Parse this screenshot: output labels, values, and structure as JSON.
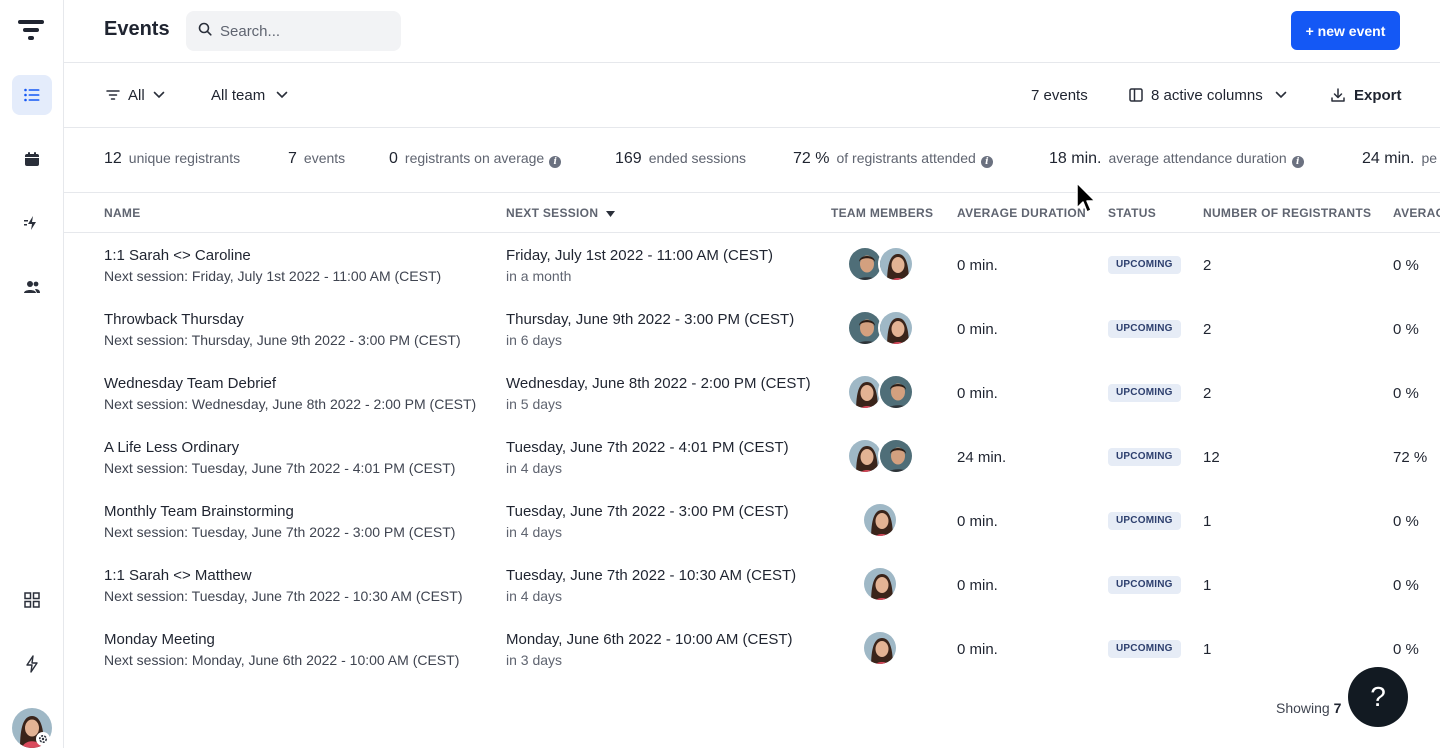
{
  "app": {
    "title": "Events"
  },
  "search": {
    "placeholder": "Search..."
  },
  "header": {
    "new_event_label": "+ new event"
  },
  "filters": {
    "type_filter": "All",
    "team_filter": "All team",
    "events_count": "7 events",
    "columns": "8 active columns",
    "export": "Export"
  },
  "stats": [
    {
      "num": "12",
      "label": "unique registrants",
      "info": false
    },
    {
      "num": "7",
      "label": "events",
      "info": false
    },
    {
      "num": "0",
      "label": "registrants on average",
      "info": true
    },
    {
      "num": "169",
      "label": "ended sessions",
      "info": false
    },
    {
      "num": "72 %",
      "label": "of registrants attended",
      "info": true
    },
    {
      "num": "18 min.",
      "label": "average attendance duration",
      "info": true
    },
    {
      "num": "24 min.",
      "label": "pe",
      "info": false
    }
  ],
  "columns": {
    "name": "NAME",
    "next_session": "NEXT SESSION",
    "team_members": "TEAM MEMBERS",
    "average_duration": "AVERAGE DURATION",
    "status": "STATUS",
    "registrants": "NUMBER OF REGISTRANTS",
    "average": "AVERAG"
  },
  "rows": [
    {
      "name": "1:1 Sarah <> Caroline",
      "sub": "Next session: Friday, July 1st 2022 - 11:00 AM (CEST)",
      "session": "Friday, July 1st 2022 - 11:00 AM (CEST)",
      "relative": "in a month",
      "members": [
        "man",
        "woman"
      ],
      "duration": "0 min.",
      "status": "UPCOMING",
      "registrants": "2",
      "average": "0 %"
    },
    {
      "name": "Throwback Thursday",
      "sub": "Next session: Thursday, June 9th 2022 - 3:00 PM (CEST)",
      "session": "Thursday, June 9th 2022 - 3:00 PM (CEST)",
      "relative": "in 6 days",
      "members": [
        "man",
        "woman"
      ],
      "duration": "0 min.",
      "status": "UPCOMING",
      "registrants": "2",
      "average": "0 %"
    },
    {
      "name": "Wednesday Team Debrief",
      "sub": "Next session: Wednesday, June 8th 2022 - 2:00 PM (CEST)",
      "session": "Wednesday, June 8th 2022 - 2:00 PM (CEST)",
      "relative": "in 5 days",
      "members": [
        "woman",
        "man"
      ],
      "duration": "0 min.",
      "status": "UPCOMING",
      "registrants": "2",
      "average": "0 %"
    },
    {
      "name": "A Life Less Ordinary",
      "sub": "Next session: Tuesday, June 7th 2022 - 4:01 PM (CEST)",
      "session": "Tuesday, June 7th 2022 - 4:01 PM (CEST)",
      "relative": "in 4 days",
      "members": [
        "woman",
        "man"
      ],
      "duration": "24 min.",
      "status": "UPCOMING",
      "registrants": "12",
      "average": "72 %"
    },
    {
      "name": "Monthly Team Brainstorming",
      "sub": "Next session: Tuesday, June 7th 2022 - 3:00 PM (CEST)",
      "session": "Tuesday, June 7th 2022 - 3:00 PM (CEST)",
      "relative": "in 4 days",
      "members": [
        "woman"
      ],
      "duration": "0 min.",
      "status": "UPCOMING",
      "registrants": "1",
      "average": "0 %"
    },
    {
      "name": "1:1 Sarah <> Matthew",
      "sub": "Next session: Tuesday, June 7th 2022 - 10:30 AM (CEST)",
      "session": "Tuesday, June 7th 2022 - 10:30 AM (CEST)",
      "relative": "in 4 days",
      "members": [
        "woman"
      ],
      "duration": "0 min.",
      "status": "UPCOMING",
      "registrants": "1",
      "average": "0 %"
    },
    {
      "name": "Monday Meeting",
      "sub": "Next session: Monday, June 6th 2022 - 10:00 AM (CEST)",
      "session": "Monday, June 6th 2022 - 10:00 AM (CEST)",
      "relative": "in 3 days",
      "members": [
        "woman"
      ],
      "duration": "0 min.",
      "status": "UPCOMING",
      "registrants": "1",
      "average": "0 %"
    }
  ],
  "footer": {
    "showing_prefix": "Showing",
    "showing_count": "7"
  },
  "help": {
    "label": "?"
  },
  "colors": {
    "accent": "#1458f5",
    "active_nav": "#e4ecfb",
    "badge_bg": "#e6ecf6",
    "help_bg": "#121a22"
  },
  "icons": [
    "logo-icon",
    "list-icon",
    "calendar-icon",
    "workflow-icon",
    "people-icon",
    "grid-icon",
    "bolt-icon",
    "search-icon",
    "filter-icon",
    "chevron-down-icon",
    "columns-icon",
    "download-icon",
    "sort-desc-icon",
    "gear-icon",
    "info-icon",
    "cursor-icon"
  ]
}
